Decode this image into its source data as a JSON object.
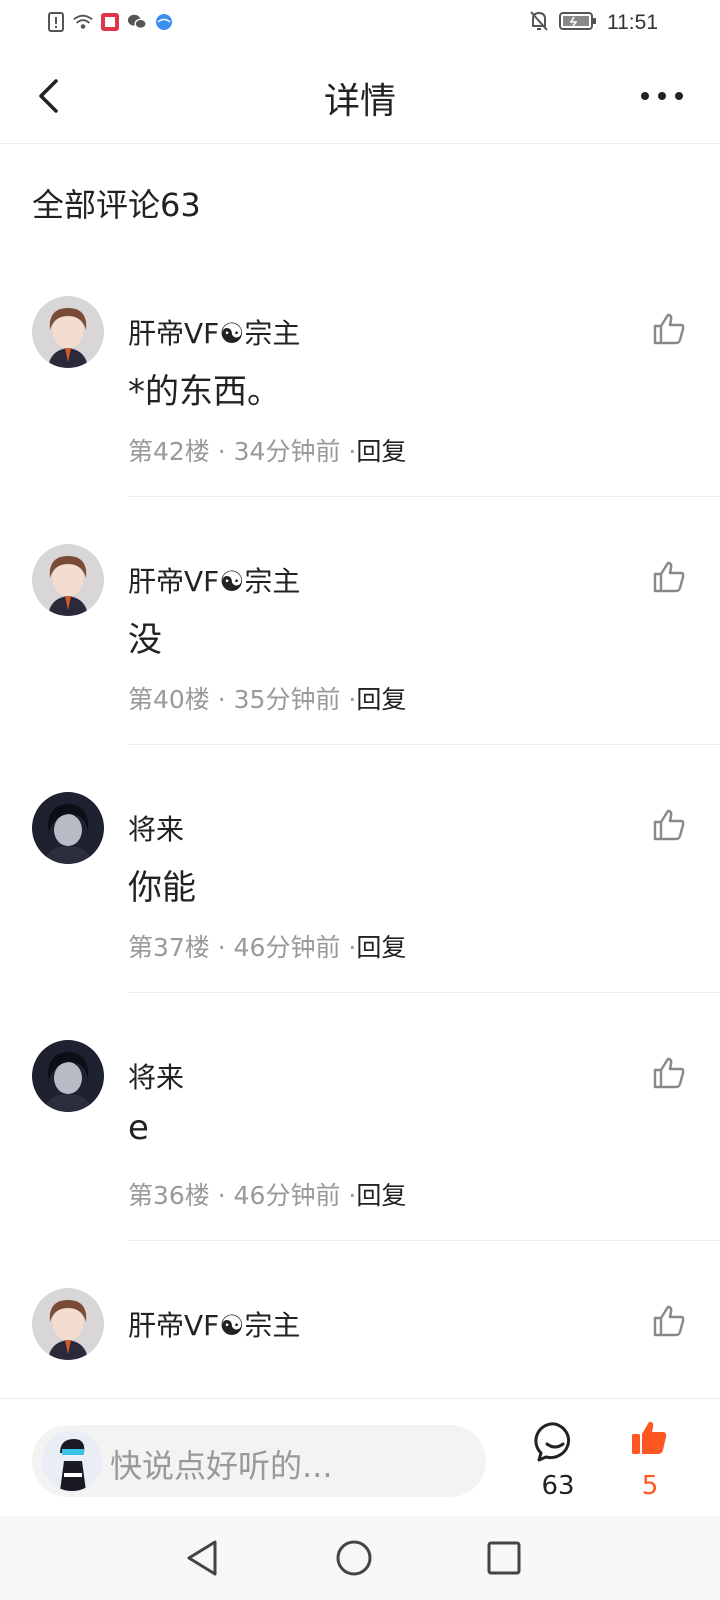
{
  "status_bar": {
    "time": "11:51"
  },
  "header": {
    "title": "详情"
  },
  "section": {
    "title": "全部评论63"
  },
  "comments": [
    {
      "name": "肝帝VF☯宗主",
      "text": "*的东西。",
      "floor": "第42楼",
      "time": "34分钟前",
      "reply": "回复",
      "avatar": "avatar-anime-boy"
    },
    {
      "name": "肝帝VF☯宗主",
      "text": "没",
      "floor": "第40楼",
      "time": "35分钟前",
      "reply": "回复",
      "avatar": "avatar-anime-boy"
    },
    {
      "name": "将来",
      "text": "你能",
      "floor": "第37楼",
      "time": "46分钟前",
      "reply": "回复",
      "avatar": "avatar-dark-anime"
    },
    {
      "name": "将来",
      "text": "e",
      "floor": "第36楼",
      "time": "46分钟前",
      "reply": "回复",
      "avatar": "avatar-dark-anime"
    },
    {
      "name": "肝帝VF☯宗主",
      "text": "",
      "floor": "",
      "time": "",
      "reply": "",
      "avatar": "avatar-anime-boy"
    }
  ],
  "bottom_bar": {
    "placeholder": "快说点好听的...",
    "comment_count": "63",
    "like_count": "5"
  },
  "colors": {
    "accent": "#ff5722",
    "muted": "#999999",
    "divider": "#ececec"
  }
}
